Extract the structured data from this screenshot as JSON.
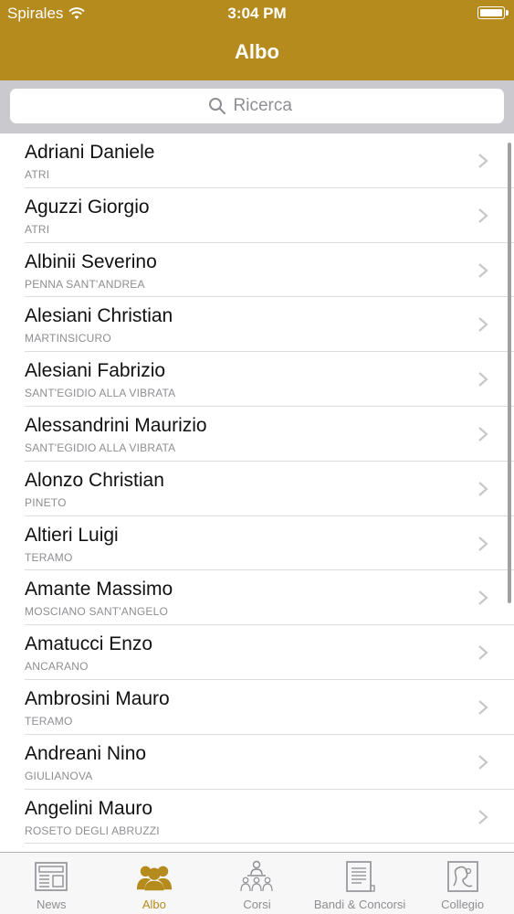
{
  "status_bar": {
    "carrier": "Spirales",
    "time": "3:04 PM"
  },
  "nav": {
    "title": "Albo"
  },
  "search": {
    "placeholder": "Ricerca"
  },
  "colors": {
    "accent": "#b48b1c",
    "search_bg": "#c9c9ce",
    "secondary_text": "#8e8e93"
  },
  "list": [
    {
      "name": "Adriani Daniele",
      "city": "ATRI"
    },
    {
      "name": "Aguzzi Giorgio",
      "city": "ATRI"
    },
    {
      "name": "Albinii Severino",
      "city": "PENNA SANT'ANDREA"
    },
    {
      "name": "Alesiani Christian",
      "city": "MARTINSICURO"
    },
    {
      "name": "Alesiani Fabrizio",
      "city": "SANT'EGIDIO ALLA VIBRATA"
    },
    {
      "name": "Alessandrini Maurizio",
      "city": "SANT'EGIDIO ALLA VIBRATA"
    },
    {
      "name": "Alonzo Christian",
      "city": "PINETO"
    },
    {
      "name": "Altieri Luigi",
      "city": "TERAMO"
    },
    {
      "name": "Amante Massimo",
      "city": "MOSCIANO SANT'ANGELO"
    },
    {
      "name": "Amatucci Enzo",
      "city": "ANCARANO"
    },
    {
      "name": "Ambrosini Mauro",
      "city": "TERAMO"
    },
    {
      "name": "Andreani Nino",
      "city": "GIULIANOVA"
    },
    {
      "name": "Angelini Mauro",
      "city": "ROSETO DEGLI ABRUZZI"
    }
  ],
  "tabs": [
    {
      "label": "News",
      "icon": "newspaper-icon",
      "active": false
    },
    {
      "label": "Albo",
      "icon": "people-icon",
      "active": true
    },
    {
      "label": "Corsi",
      "icon": "classroom-icon",
      "active": false
    },
    {
      "label": "Bandi & Concorsi",
      "icon": "document-icon",
      "active": false
    },
    {
      "label": "Collegio",
      "icon": "map-icon",
      "active": false
    }
  ]
}
